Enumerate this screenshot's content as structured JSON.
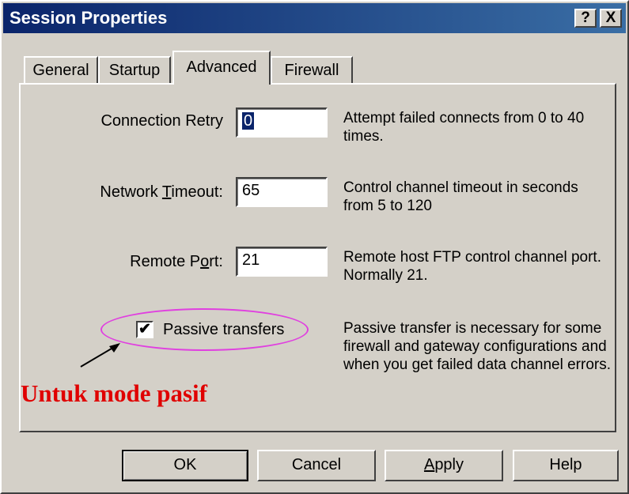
{
  "window": {
    "title": "Session Properties"
  },
  "title_buttons": {
    "help": "?",
    "close": "X"
  },
  "tabs": [
    {
      "label": "General",
      "selected": false
    },
    {
      "label": "Startup",
      "selected": false
    },
    {
      "label": "Advanced",
      "selected": true
    },
    {
      "label": "Firewall",
      "selected": false
    }
  ],
  "fields": {
    "connection_retry": {
      "label": "Connection Retry",
      "value": "0",
      "description": "Attempt failed connects from 0 to 40 times."
    },
    "network_timeout": {
      "label_before": "Network ",
      "label_mnemonic": "T",
      "label_after": "imeout:",
      "value": "65",
      "description": "Control channel timeout in seconds from 5 to 120"
    },
    "remote_port": {
      "label_before": "Remote P",
      "label_mnemonic": "o",
      "label_after": "rt:",
      "value": "21",
      "description": "Remote host FTP control channel port. Normally 21."
    },
    "passive_transfers": {
      "label": "Passive transfers",
      "checked": true,
      "check_glyph": "✔",
      "description": "Passive transfer is necessary for some firewall and gateway configurations and when you get failed data channel errors."
    }
  },
  "annotation": {
    "text": "Untuk mode pasif",
    "color": "#e00000",
    "ellipse_color": "#e040e0"
  },
  "buttons": {
    "ok": "OK",
    "cancel": "Cancel",
    "apply_mnemonic": "A",
    "apply_rest": "pply",
    "help": "Help"
  }
}
